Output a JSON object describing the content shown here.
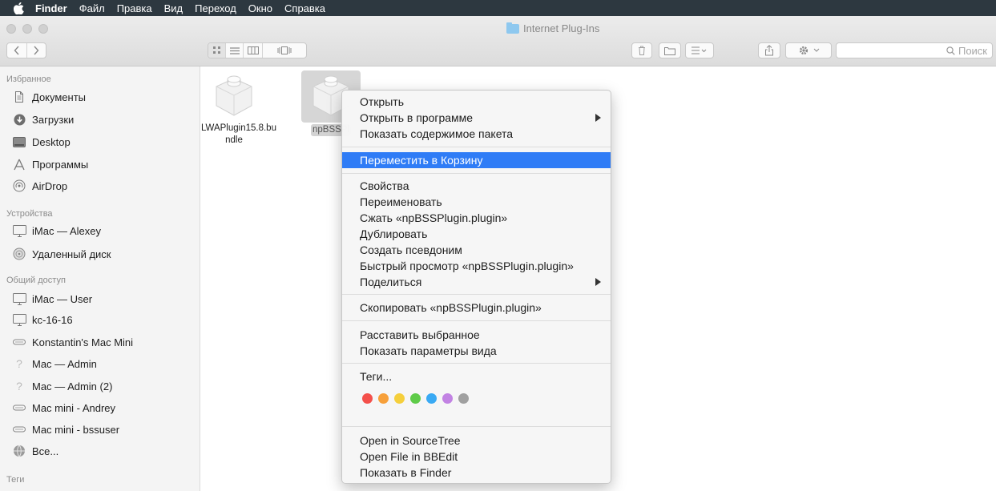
{
  "menubar": {
    "app": "Finder",
    "items": [
      "Файл",
      "Правка",
      "Вид",
      "Переход",
      "Окно",
      "Справка"
    ]
  },
  "window": {
    "title": "Internet Plug-Ins",
    "search_placeholder": "Поиск"
  },
  "sidebar": {
    "sections": [
      {
        "header": "Избранное",
        "items": [
          {
            "label": "Документы",
            "icon": "documents-icon"
          },
          {
            "label": "Загрузки",
            "icon": "downloads-icon"
          },
          {
            "label": "Desktop",
            "icon": "desktop-icon"
          },
          {
            "label": "Программы",
            "icon": "applications-icon"
          },
          {
            "label": "AirDrop",
            "icon": "airdrop-icon"
          }
        ]
      },
      {
        "header": "Устройства",
        "items": [
          {
            "label": "iMac — Alexey",
            "icon": "imac-icon"
          },
          {
            "label": "Удаленный диск",
            "icon": "remote-disc-icon"
          }
        ]
      },
      {
        "header": "Общий доступ",
        "items": [
          {
            "label": "iMac — User",
            "icon": "imac-icon"
          },
          {
            "label": "kc-16-16",
            "icon": "imac-icon"
          },
          {
            "label": "Konstantin's Mac Mini",
            "icon": "mac-mini-icon"
          },
          {
            "label": "Mac — Admin",
            "icon": "unknown-computer-icon"
          },
          {
            "label": "Mac — Admin (2)",
            "icon": "unknown-computer-icon"
          },
          {
            "label": "Mac mini - Andrey",
            "icon": "mac-mini-icon"
          },
          {
            "label": "Mac mini - bssuser",
            "icon": "mac-mini-icon"
          },
          {
            "label": "Все...",
            "icon": "network-globe-icon"
          }
        ]
      },
      {
        "header": "Теги",
        "items": []
      }
    ]
  },
  "files": [
    {
      "name_line1": "LWAPlugin15.8.bu",
      "name_line2": "ndle",
      "selected": false
    },
    {
      "name_line1": "npBSSPl",
      "name_line2": "",
      "selected": true
    }
  ],
  "context_menu": {
    "items": {
      "open": "Открыть",
      "open_with": "Открыть в программе",
      "show_package": "Показать содержимое пакета",
      "move_to_trash": "Переместить в Корзину",
      "get_info": "Свойства",
      "rename": "Переименовать",
      "compress": "Сжать «npBSSPlugin.plugin»",
      "duplicate": "Дублировать",
      "make_alias": "Создать псевдоним",
      "quick_look": "Быстрый просмотр «npBSSPlugin.plugin»",
      "share": "Поделиться",
      "copy": "Скопировать «npBSSPlugin.plugin»",
      "arrange": "Расставить выбранное",
      "view_options": "Показать параметры вида",
      "tags": "Теги...",
      "open_sourcetree": "Open in SourceTree",
      "open_bbedit": "Open File in BBEdit",
      "show_in_finder": "Показать в Finder"
    },
    "highlighted": "move_to_trash",
    "tag_colors": [
      "#f4504b",
      "#f7a03a",
      "#f5cf3c",
      "#5fcb49",
      "#3aaaf4",
      "#c283e3",
      "#a0a0a0"
    ]
  }
}
